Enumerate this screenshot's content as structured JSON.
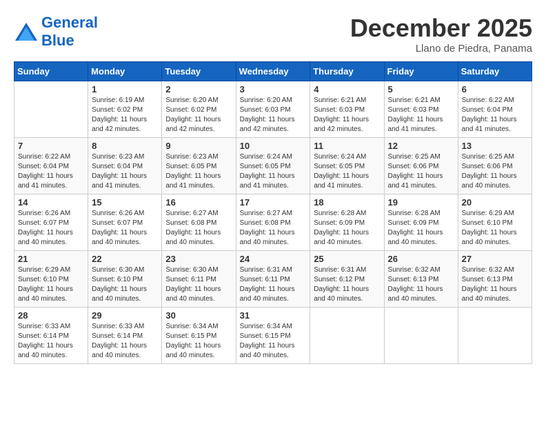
{
  "header": {
    "logo_text_general": "General",
    "logo_text_blue": "Blue",
    "month_year": "December 2025",
    "location": "Llano de Piedra, Panama"
  },
  "days_of_week": [
    "Sunday",
    "Monday",
    "Tuesday",
    "Wednesday",
    "Thursday",
    "Friday",
    "Saturday"
  ],
  "weeks": [
    [
      {
        "num": "",
        "sunrise": "",
        "sunset": "",
        "daylight": ""
      },
      {
        "num": "1",
        "sunrise": "Sunrise: 6:19 AM",
        "sunset": "Sunset: 6:02 PM",
        "daylight": "Daylight: 11 hours and 42 minutes."
      },
      {
        "num": "2",
        "sunrise": "Sunrise: 6:20 AM",
        "sunset": "Sunset: 6:02 PM",
        "daylight": "Daylight: 11 hours and 42 minutes."
      },
      {
        "num": "3",
        "sunrise": "Sunrise: 6:20 AM",
        "sunset": "Sunset: 6:03 PM",
        "daylight": "Daylight: 11 hours and 42 minutes."
      },
      {
        "num": "4",
        "sunrise": "Sunrise: 6:21 AM",
        "sunset": "Sunset: 6:03 PM",
        "daylight": "Daylight: 11 hours and 42 minutes."
      },
      {
        "num": "5",
        "sunrise": "Sunrise: 6:21 AM",
        "sunset": "Sunset: 6:03 PM",
        "daylight": "Daylight: 11 hours and 41 minutes."
      },
      {
        "num": "6",
        "sunrise": "Sunrise: 6:22 AM",
        "sunset": "Sunset: 6:04 PM",
        "daylight": "Daylight: 11 hours and 41 minutes."
      }
    ],
    [
      {
        "num": "7",
        "sunrise": "Sunrise: 6:22 AM",
        "sunset": "Sunset: 6:04 PM",
        "daylight": "Daylight: 11 hours and 41 minutes."
      },
      {
        "num": "8",
        "sunrise": "Sunrise: 6:23 AM",
        "sunset": "Sunset: 6:04 PM",
        "daylight": "Daylight: 11 hours and 41 minutes."
      },
      {
        "num": "9",
        "sunrise": "Sunrise: 6:23 AM",
        "sunset": "Sunset: 6:05 PM",
        "daylight": "Daylight: 11 hours and 41 minutes."
      },
      {
        "num": "10",
        "sunrise": "Sunrise: 6:24 AM",
        "sunset": "Sunset: 6:05 PM",
        "daylight": "Daylight: 11 hours and 41 minutes."
      },
      {
        "num": "11",
        "sunrise": "Sunrise: 6:24 AM",
        "sunset": "Sunset: 6:05 PM",
        "daylight": "Daylight: 11 hours and 41 minutes."
      },
      {
        "num": "12",
        "sunrise": "Sunrise: 6:25 AM",
        "sunset": "Sunset: 6:06 PM",
        "daylight": "Daylight: 11 hours and 41 minutes."
      },
      {
        "num": "13",
        "sunrise": "Sunrise: 6:25 AM",
        "sunset": "Sunset: 6:06 PM",
        "daylight": "Daylight: 11 hours and 40 minutes."
      }
    ],
    [
      {
        "num": "14",
        "sunrise": "Sunrise: 6:26 AM",
        "sunset": "Sunset: 6:07 PM",
        "daylight": "Daylight: 11 hours and 40 minutes."
      },
      {
        "num": "15",
        "sunrise": "Sunrise: 6:26 AM",
        "sunset": "Sunset: 6:07 PM",
        "daylight": "Daylight: 11 hours and 40 minutes."
      },
      {
        "num": "16",
        "sunrise": "Sunrise: 6:27 AM",
        "sunset": "Sunset: 6:08 PM",
        "daylight": "Daylight: 11 hours and 40 minutes."
      },
      {
        "num": "17",
        "sunrise": "Sunrise: 6:27 AM",
        "sunset": "Sunset: 6:08 PM",
        "daylight": "Daylight: 11 hours and 40 minutes."
      },
      {
        "num": "18",
        "sunrise": "Sunrise: 6:28 AM",
        "sunset": "Sunset: 6:09 PM",
        "daylight": "Daylight: 11 hours and 40 minutes."
      },
      {
        "num": "19",
        "sunrise": "Sunrise: 6:28 AM",
        "sunset": "Sunset: 6:09 PM",
        "daylight": "Daylight: 11 hours and 40 minutes."
      },
      {
        "num": "20",
        "sunrise": "Sunrise: 6:29 AM",
        "sunset": "Sunset: 6:10 PM",
        "daylight": "Daylight: 11 hours and 40 minutes."
      }
    ],
    [
      {
        "num": "21",
        "sunrise": "Sunrise: 6:29 AM",
        "sunset": "Sunset: 6:10 PM",
        "daylight": "Daylight: 11 hours and 40 minutes."
      },
      {
        "num": "22",
        "sunrise": "Sunrise: 6:30 AM",
        "sunset": "Sunset: 6:10 PM",
        "daylight": "Daylight: 11 hours and 40 minutes."
      },
      {
        "num": "23",
        "sunrise": "Sunrise: 6:30 AM",
        "sunset": "Sunset: 6:11 PM",
        "daylight": "Daylight: 11 hours and 40 minutes."
      },
      {
        "num": "24",
        "sunrise": "Sunrise: 6:31 AM",
        "sunset": "Sunset: 6:11 PM",
        "daylight": "Daylight: 11 hours and 40 minutes."
      },
      {
        "num": "25",
        "sunrise": "Sunrise: 6:31 AM",
        "sunset": "Sunset: 6:12 PM",
        "daylight": "Daylight: 11 hours and 40 minutes."
      },
      {
        "num": "26",
        "sunrise": "Sunrise: 6:32 AM",
        "sunset": "Sunset: 6:13 PM",
        "daylight": "Daylight: 11 hours and 40 minutes."
      },
      {
        "num": "27",
        "sunrise": "Sunrise: 6:32 AM",
        "sunset": "Sunset: 6:13 PM",
        "daylight": "Daylight: 11 hours and 40 minutes."
      }
    ],
    [
      {
        "num": "28",
        "sunrise": "Sunrise: 6:33 AM",
        "sunset": "Sunset: 6:14 PM",
        "daylight": "Daylight: 11 hours and 40 minutes."
      },
      {
        "num": "29",
        "sunrise": "Sunrise: 6:33 AM",
        "sunset": "Sunset: 6:14 PM",
        "daylight": "Daylight: 11 hours and 40 minutes."
      },
      {
        "num": "30",
        "sunrise": "Sunrise: 6:34 AM",
        "sunset": "Sunset: 6:15 PM",
        "daylight": "Daylight: 11 hours and 40 minutes."
      },
      {
        "num": "31",
        "sunrise": "Sunrise: 6:34 AM",
        "sunset": "Sunset: 6:15 PM",
        "daylight": "Daylight: 11 hours and 40 minutes."
      },
      {
        "num": "",
        "sunrise": "",
        "sunset": "",
        "daylight": ""
      },
      {
        "num": "",
        "sunrise": "",
        "sunset": "",
        "daylight": ""
      },
      {
        "num": "",
        "sunrise": "",
        "sunset": "",
        "daylight": ""
      }
    ]
  ]
}
